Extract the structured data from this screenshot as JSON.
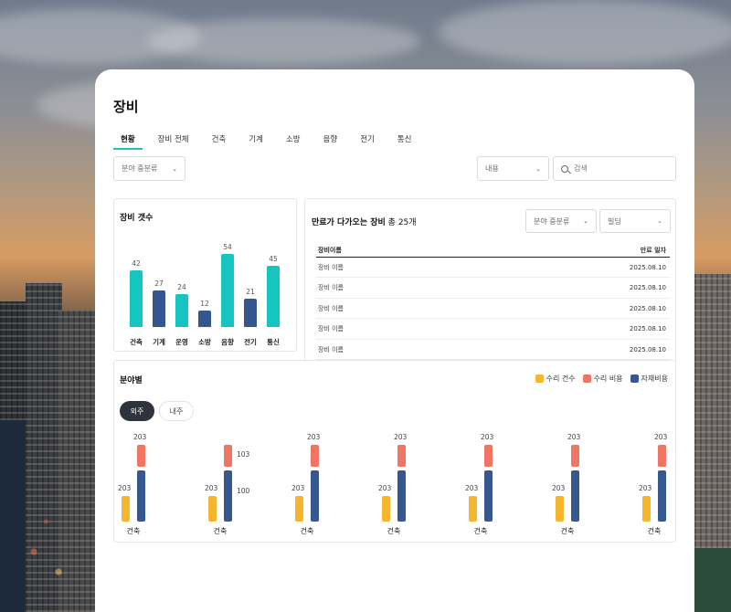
{
  "page": {
    "title": "장비"
  },
  "tabs": [
    "현황",
    "장비 전체",
    "건축",
    "기계",
    "소방",
    "음향",
    "전기",
    "통신"
  ],
  "filters": {
    "category_select": "분야 중분류",
    "content_select": "내용",
    "search_placeholder": "검색"
  },
  "count_panel": {
    "title": "장비 갯수"
  },
  "expiry_panel": {
    "title_bold": "만료가 다가오는 장비",
    "title_total": "총 25개",
    "filter_category": "분야 중분류",
    "filter_building": "빌딩",
    "columns": [
      "장비이름",
      "만료 일자"
    ],
    "rows": [
      [
        "장비 이름",
        "2025.08.10"
      ],
      [
        "장비 이름",
        "2025.08.10"
      ],
      [
        "장비 이름",
        "2025.08.10"
      ],
      [
        "장비 이름",
        "2025.08.10"
      ],
      [
        "장비 이름",
        "2025.08.10"
      ]
    ]
  },
  "category_panel": {
    "title": "분야별",
    "toggle": [
      "외주",
      "내주"
    ],
    "toggle_selected": "외주"
  },
  "colors": {
    "accent": "#1fc3b8",
    "teal": "#15c5bf",
    "navy": "#34558f",
    "repair_count": "#f5b52e",
    "repair_cost": "#f07562",
    "material_cost": "#35588e"
  },
  "chart_data": [
    {
      "type": "bar",
      "title": "장비 갯수",
      "categories": [
        "건축",
        "기계",
        "운영",
        "소방",
        "음향",
        "전기",
        "통신"
      ],
      "values": [
        42,
        27,
        24,
        12,
        54,
        21,
        45
      ],
      "ylim": [
        0,
        54
      ]
    },
    {
      "type": "bar",
      "title": "분야별",
      "legend": "top-right",
      "categories": [
        "건축",
        "건축",
        "건축",
        "건축",
        "건축",
        "건축",
        "건축"
      ],
      "series": [
        {
          "name": "수리 건수",
          "values": [
            203,
            203,
            203,
            203,
            203,
            203,
            203
          ],
          "labels": [
            "203",
            "203",
            "203",
            "203",
            "203",
            "203",
            "203"
          ]
        },
        {
          "name": "수리 비용",
          "values": [
            203,
            103,
            203,
            203,
            203,
            203,
            203
          ],
          "labels": [
            "203",
            "103",
            "203",
            "203",
            "203",
            "203",
            "203"
          ]
        },
        {
          "name": "자재비용",
          "values": [
            100,
            100,
            100,
            100,
            100,
            100,
            100
          ],
          "labels": [
            "",
            "100",
            "",
            "",
            "",
            "",
            ""
          ]
        }
      ]
    }
  ]
}
